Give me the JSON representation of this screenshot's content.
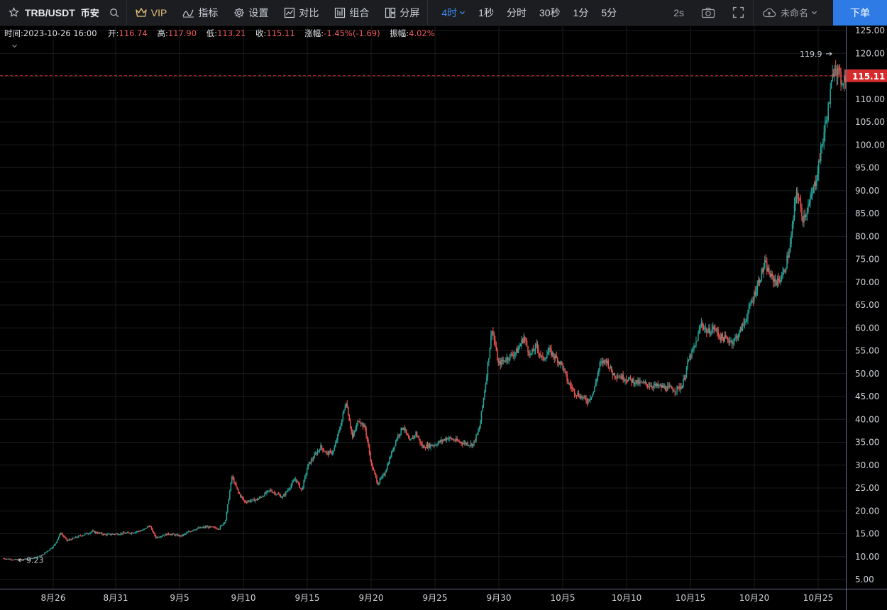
{
  "toolbar": {
    "symbol": "TRB/USDT",
    "exchange": "币安",
    "vip": "VIP",
    "indicators": "指标",
    "settings": "设置",
    "compare": "对比",
    "combo": "组合",
    "split": "分屏",
    "intervals": [
      "4时",
      "1秒",
      "分时",
      "30秒",
      "1分",
      "5分"
    ],
    "interval_active": 0,
    "refresh": "2s",
    "layout_name": "未命名",
    "order": "下单"
  },
  "colors": {
    "up": "#26a69a",
    "down": "#ef5350",
    "accent": "#2f7be6",
    "grid": "#1b1c20",
    "last_price": "#d42c2c"
  },
  "ohlc": {
    "time_label": "时间:",
    "time": "2023-10-26 16:00",
    "open_label": "开:",
    "open": "116.74",
    "high_label": "高:",
    "high": "117.90",
    "low_label": "低:",
    "low": "113.21",
    "close_label": "收:",
    "close": "115.11",
    "change_label": "涨幅:",
    "change": "-1.45%(-1.69)",
    "amp_label": "振幅:",
    "amp": "4.02%"
  },
  "chart_data": {
    "type": "candlestick",
    "y_ticks": [
      "125.00",
      "120.00",
      "115.00",
      "110.00",
      "105.00",
      "100.00",
      "95.00",
      "90.00",
      "85.00",
      "80.00",
      "75.00",
      "70.00",
      "65.00",
      "60.00",
      "55.00",
      "50.00",
      "45.00",
      "40.00",
      "35.00",
      "30.00",
      "25.00",
      "20.00",
      "15.00",
      "10.00",
      "5.00"
    ],
    "x_ticks": [
      "8月26",
      "8月31",
      "9月5",
      "9月10",
      "9月15",
      "9月20",
      "9月25",
      "9月30",
      "10月5",
      "10月10",
      "10月15",
      "10月20",
      "10月25"
    ],
    "last_price": "115.11",
    "max_label": "119.9",
    "min_label": "9.23",
    "series": [
      [
        0,
        9.6
      ],
      [
        2,
        9.3
      ],
      [
        4,
        9.5
      ],
      [
        6,
        10.2
      ],
      [
        8,
        12.5
      ],
      [
        9,
        15.2
      ],
      [
        10,
        13.5
      ],
      [
        12,
        14.5
      ],
      [
        14,
        15.5
      ],
      [
        16,
        14.8
      ],
      [
        18,
        15.0
      ],
      [
        20,
        15.2
      ],
      [
        22,
        15.8
      ],
      [
        23,
        16.8
      ],
      [
        24,
        14.2
      ],
      [
        26,
        15.0
      ],
      [
        28,
        14.5
      ],
      [
        30,
        16.0
      ],
      [
        32,
        16.5
      ],
      [
        34,
        16.2
      ],
      [
        35,
        18.0
      ],
      [
        36,
        27.5
      ],
      [
        37,
        24.0
      ],
      [
        38,
        22.0
      ],
      [
        40,
        22.5
      ],
      [
        42,
        24.5
      ],
      [
        44,
        23.0
      ],
      [
        46,
        27.0
      ],
      [
        47,
        24.5
      ],
      [
        48,
        30.0
      ],
      [
        50,
        34.0
      ],
      [
        51,
        32.5
      ],
      [
        52,
        33.0
      ],
      [
        53,
        38.0
      ],
      [
        54,
        44.0
      ],
      [
        55,
        36.0
      ],
      [
        56,
        40.0
      ],
      [
        57,
        38.0
      ],
      [
        58,
        30.0
      ],
      [
        59,
        26.0
      ],
      [
        60,
        28.0
      ],
      [
        61,
        32.0
      ],
      [
        62,
        36.0
      ],
      [
        63,
        38.5
      ],
      [
        64,
        35.0
      ],
      [
        65,
        37.0
      ],
      [
        66,
        34.0
      ],
      [
        68,
        34.5
      ],
      [
        70,
        36.0
      ],
      [
        72,
        35.0
      ],
      [
        74,
        34.5
      ],
      [
        75,
        38.0
      ],
      [
        76,
        48.0
      ],
      [
        77,
        60.0
      ],
      [
        78,
        52.0
      ],
      [
        80,
        54.0
      ],
      [
        81,
        55.0
      ],
      [
        82,
        58.0
      ],
      [
        83,
        54.0
      ],
      [
        84,
        56.0
      ],
      [
        85,
        53.0
      ],
      [
        86,
        55.0
      ],
      [
        88,
        52.0
      ],
      [
        89,
        48.0
      ],
      [
        90,
        46.0
      ],
      [
        92,
        44.0
      ],
      [
        93,
        46.0
      ],
      [
        94,
        52.0
      ],
      [
        95,
        53.0
      ],
      [
        96,
        50.0
      ],
      [
        97,
        49.5
      ],
      [
        98,
        49.0
      ],
      [
        100,
        48.0
      ],
      [
        102,
        47.5
      ],
      [
        104,
        47.0
      ],
      [
        106,
        46.5
      ],
      [
        107,
        47.5
      ],
      [
        108,
        53.0
      ],
      [
        109,
        56.0
      ],
      [
        110,
        61.0
      ],
      [
        111,
        59.0
      ],
      [
        112,
        60.0
      ],
      [
        113,
        58.0
      ],
      [
        115,
        57.0
      ],
      [
        116,
        59.0
      ],
      [
        117,
        62.0
      ],
      [
        118,
        66.0
      ],
      [
        119,
        70.0
      ],
      [
        120,
        74.0
      ],
      [
        121,
        71.0
      ],
      [
        122,
        70.0
      ],
      [
        123,
        72.0
      ],
      [
        124,
        78.0
      ],
      [
        125,
        90.0
      ],
      [
        126,
        84.0
      ],
      [
        127,
        87.0
      ],
      [
        128,
        92.0
      ],
      [
        129,
        100.0
      ],
      [
        130,
        108.0
      ],
      [
        131,
        118.0
      ],
      [
        132,
        114.0
      ],
      [
        132.7,
        115.1
      ]
    ]
  }
}
